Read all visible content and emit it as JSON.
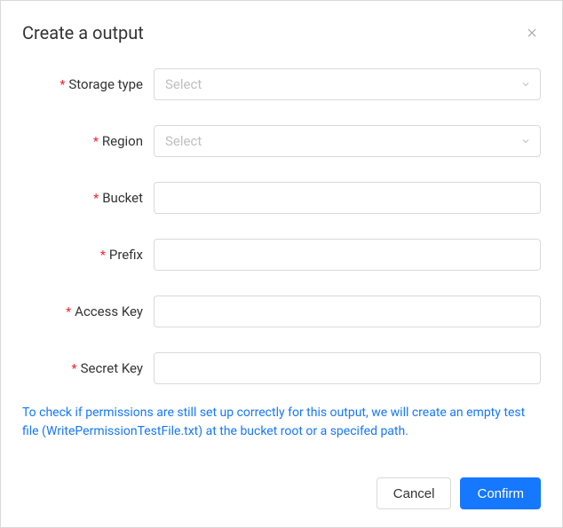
{
  "dialog": {
    "title": "Create a output"
  },
  "form": {
    "storage_type": {
      "label": "Storage type",
      "placeholder": "Select",
      "value": ""
    },
    "region": {
      "label": "Region",
      "placeholder": "Select",
      "value": ""
    },
    "bucket": {
      "label": "Bucket",
      "value": ""
    },
    "prefix": {
      "label": "Prefix",
      "value": ""
    },
    "access_key": {
      "label": "Access Key",
      "value": ""
    },
    "secret_key": {
      "label": "Secret Key",
      "value": ""
    }
  },
  "info_text": "To check if permissions are still set up correctly for this output, we will create an empty test file (WritePermissionTestFile.txt) at the bucket root or a specifed path.",
  "buttons": {
    "cancel": "Cancel",
    "confirm": "Confirm"
  }
}
